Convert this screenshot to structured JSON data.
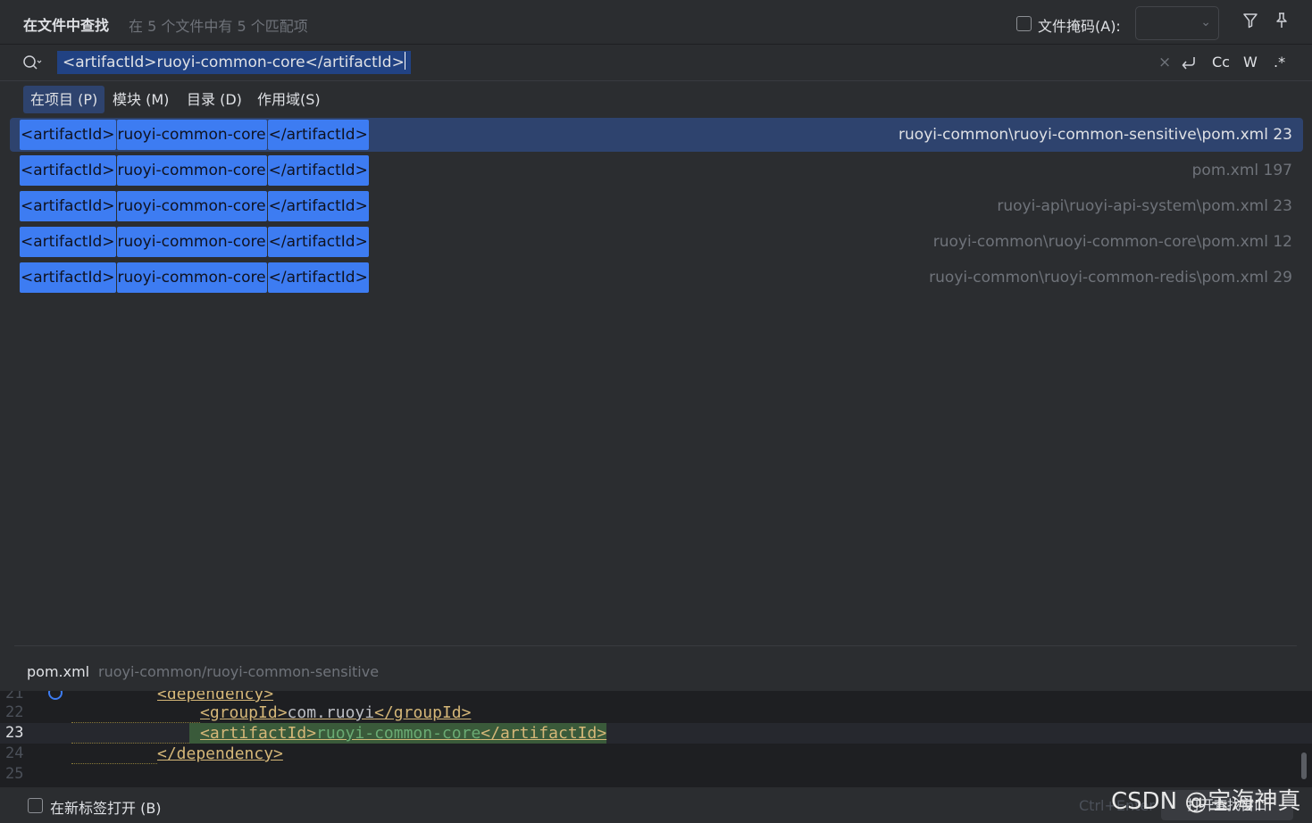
{
  "header": {
    "title": "在文件中查找",
    "subtitle": "在 5 个文件中有 5 个匹配项",
    "file_mask_label": "文件掩码(A):",
    "file_mask_value": ""
  },
  "search": {
    "query": "<artifactId>ruoyi-common-core</artifactId>",
    "clear_symbol": "×",
    "match_case_label": "Cc",
    "words_label": "W",
    "regex_label": ".*"
  },
  "scopes": [
    {
      "label": "在项目 (P)",
      "active": true
    },
    {
      "label": "模块 (M)",
      "active": false
    },
    {
      "label": "目录 (D)",
      "active": false
    },
    {
      "label": "作用域(S)",
      "active": false
    }
  ],
  "results": [
    {
      "segments": [
        "<artifactId>",
        "ruoyi-common-core",
        "</artifactId>"
      ],
      "path": "ruoyi-common\\ruoyi-common-sensitive\\pom.xml 23",
      "selected": true
    },
    {
      "segments": [
        "<artifactId>",
        "ruoyi-common-core",
        "</artifactId>"
      ],
      "path": "pom.xml 197",
      "selected": false
    },
    {
      "segments": [
        "<artifactId>",
        "ruoyi-common-core",
        "</artifactId>"
      ],
      "path": "ruoyi-api\\ruoyi-api-system\\pom.xml 23",
      "selected": false
    },
    {
      "segments": [
        "<artifactId>",
        "ruoyi-common-core",
        "</artifactId>"
      ],
      "path": "ruoyi-common\\ruoyi-common-core\\pom.xml 12",
      "selected": false
    },
    {
      "segments": [
        "<artifactId>",
        "ruoyi-common-core",
        "</artifactId>"
      ],
      "path": "ruoyi-common\\ruoyi-common-redis\\pom.xml 29",
      "selected": false
    }
  ],
  "preview": {
    "file_name": "pom.xml",
    "file_path": "ruoyi-common/ruoyi-common-sensitive",
    "lines": [
      {
        "num": "21",
        "open": "<dependency>",
        "text": "",
        "close": ""
      },
      {
        "num": "22",
        "open": "<groupId>",
        "text": "com.ruoyi",
        "close": "</groupId>"
      },
      {
        "num": "23",
        "open": "<artifactId>",
        "text": "ruoyi-common-core",
        "close": "</artifactId>"
      },
      {
        "num": "24",
        "open": "</dependency>",
        "text": "",
        "close": ""
      },
      {
        "num": "25",
        "open": "",
        "text": "",
        "close": ""
      }
    ]
  },
  "footer": {
    "new_tab_label": "在新标签打开 (B)",
    "shortcut": "Ctrl+Enter",
    "open_button": "打开查找窗口"
  },
  "watermark": "CSDN @宝海神真"
}
